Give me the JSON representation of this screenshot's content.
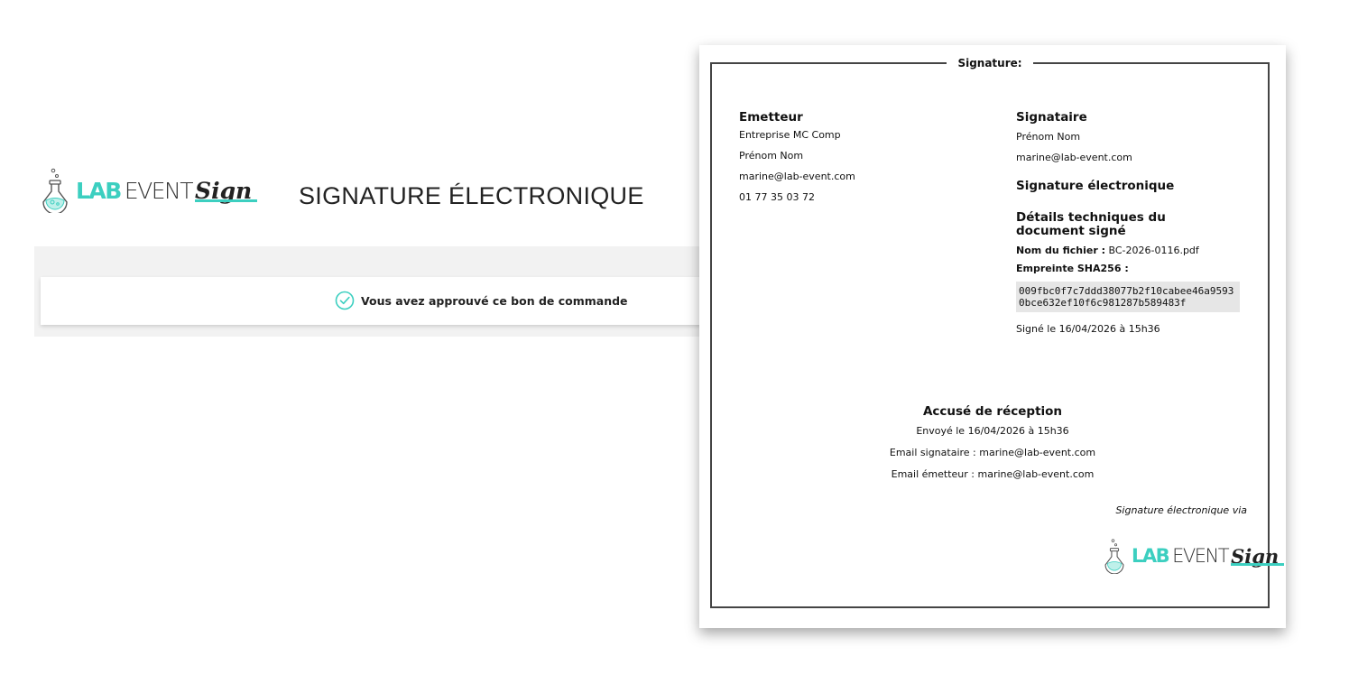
{
  "brand": {
    "lab": "LAB",
    "event": "EVENT",
    "sign": "Sign"
  },
  "page": {
    "title": "SIGNATURE ÉLECTRONIQUE"
  },
  "approval": {
    "message": "Vous avez approuvé ce bon de commande"
  },
  "document": {
    "frame_label": "Signature:",
    "emitter": {
      "heading": "Emetteur",
      "company": "Entreprise MC Comp",
      "name": "Prénom Nom",
      "email": "marine@lab-event.com",
      "phone": "01 77 35 03 72"
    },
    "signer": {
      "heading": "Signataire",
      "name": "Prénom Nom",
      "email": "marine@lab-event.com",
      "esign_heading": "Signature électronique",
      "tech_heading": "Détails techniques du document signé",
      "file_label": "Nom du fichier :",
      "file_value": "BC-2026-0116.pdf",
      "hash_label": "Empreinte SHA256 :",
      "hash_value": "009fbc0f7c7ddd38077b2f10cabee46a95930bce632ef10f6c981287b589483f",
      "signed_at": "Signé le 16/04/2026 à 15h36"
    },
    "receipt": {
      "heading": "Accusé de réception",
      "sent": "Envoyé le 16/04/2026 à 15h36",
      "signer_email": "Email signataire : marine@lab-event.com",
      "emitter_email": "Email émetteur : marine@lab-event.com"
    },
    "via": "Signature électronique via"
  },
  "colors": {
    "accent": "#3ccfc0",
    "check": "#3ccfc0"
  }
}
